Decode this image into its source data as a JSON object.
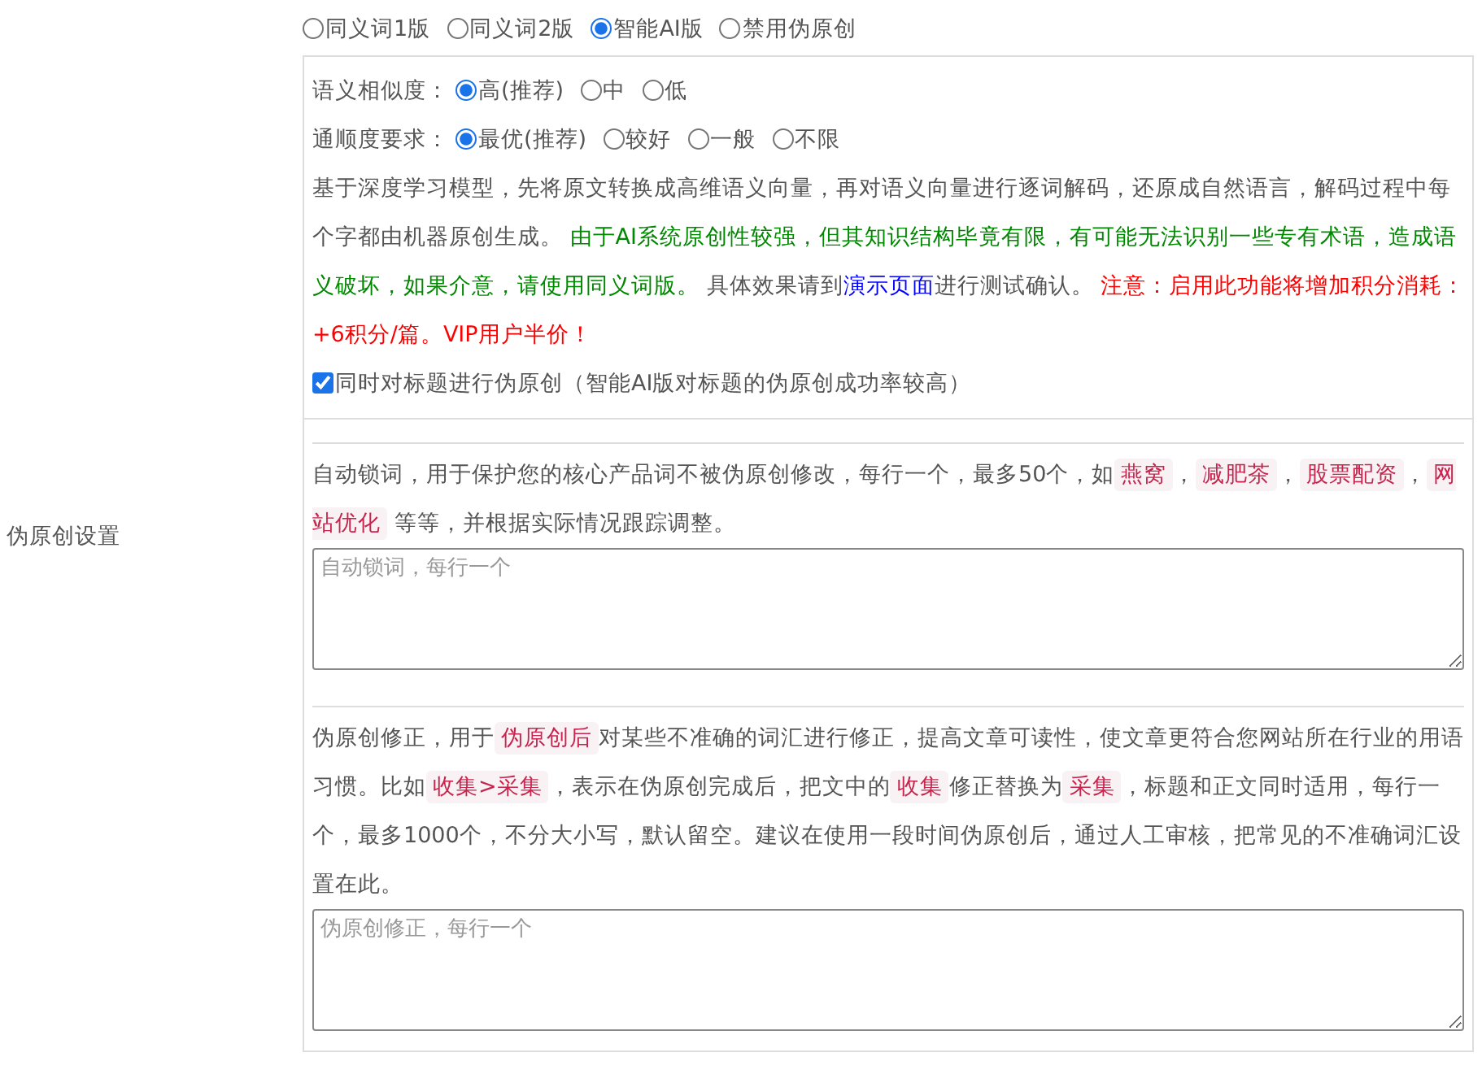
{
  "section_label": "伪原创设置",
  "modes": [
    {
      "label": "同义词1版",
      "selected": false
    },
    {
      "label": "同义词2版",
      "selected": false
    },
    {
      "label": "智能AI版",
      "selected": true
    },
    {
      "label": "禁用伪原创",
      "selected": false
    }
  ],
  "ai_options": {
    "settings": [
      {
        "label": "语义相似度：",
        "options": [
          {
            "label": "高(推荐)",
            "selected": true
          },
          {
            "label": "中",
            "selected": false
          },
          {
            "label": "低",
            "selected": false
          }
        ]
      },
      {
        "label": "通顺度要求：",
        "options": [
          {
            "label": "最优(推荐)",
            "selected": true
          },
          {
            "label": "较好",
            "selected": false
          },
          {
            "label": "一般",
            "selected": false
          },
          {
            "label": "不限",
            "selected": false
          }
        ]
      }
    ],
    "description": [
      {
        "kind": "text",
        "text": "基于深度学习模型，先将原文转换成高维语义向量，再对语义向量进行逐词解码，还原成自然语言，解码过程中每个字都由机器原创生成。 "
      },
      {
        "kind": "green",
        "text": "由于AI系统原创性较强，但其知识结构毕竟有限，有可能无法识别一些专有术语，造成语义破坏，如果介意，请使用同义词版。"
      },
      {
        "kind": "text",
        "text": " 具体效果请到"
      },
      {
        "kind": "link",
        "text": "演示页面"
      },
      {
        "kind": "text",
        "text": "进行测试确认。 "
      },
      {
        "kind": "red",
        "text": "注意：启用此功能将增加积分消耗：+6积分/篇。VIP用户半价！"
      }
    ],
    "title_option": {
      "label": "同时对标题进行伪原创（智能AI版对标题的伪原创成功率较高）",
      "checked": true
    }
  },
  "lock_words": {
    "description": [
      {
        "kind": "text",
        "text": "自动锁词，用于保护您的核心产品词不被伪原创修改，每行一个，最多50个，如"
      },
      {
        "kind": "tag",
        "text": "燕窝"
      },
      {
        "kind": "text",
        "text": "，"
      },
      {
        "kind": "tag",
        "text": "减肥茶"
      },
      {
        "kind": "text",
        "text": "，"
      },
      {
        "kind": "tag",
        "text": "股票配资"
      },
      {
        "kind": "text",
        "text": "，"
      },
      {
        "kind": "tag",
        "text": "网站优化"
      },
      {
        "kind": "text",
        "text": " 等等，并根据实际情况跟踪调整。"
      }
    ],
    "placeholder": "自动锁词，每行一个"
  },
  "correction": {
    "description": [
      {
        "kind": "text",
        "text": "伪原创修正，用于"
      },
      {
        "kind": "tag",
        "text": "伪原创后"
      },
      {
        "kind": "text",
        "text": "对某些不准确的词汇进行修正，提高文章可读性，使文章更符合您网站所在行业的用语习惯。比如"
      },
      {
        "kind": "tag",
        "text": "收集>采集"
      },
      {
        "kind": "text",
        "text": "，表示在伪原创完成后，把文中的"
      },
      {
        "kind": "tag",
        "text": "收集"
      },
      {
        "kind": "text",
        "text": "修正替换为"
      },
      {
        "kind": "tag",
        "text": "采集"
      },
      {
        "kind": "text",
        "text": "，标题和正文同时适用，每行一个，最多1000个，不分大小写，默认留空。建议在使用一段时间伪原创后，通过人工审核，把常见的不准确词汇设置在此。"
      }
    ],
    "placeholder": "伪原创修正，每行一个"
  }
}
